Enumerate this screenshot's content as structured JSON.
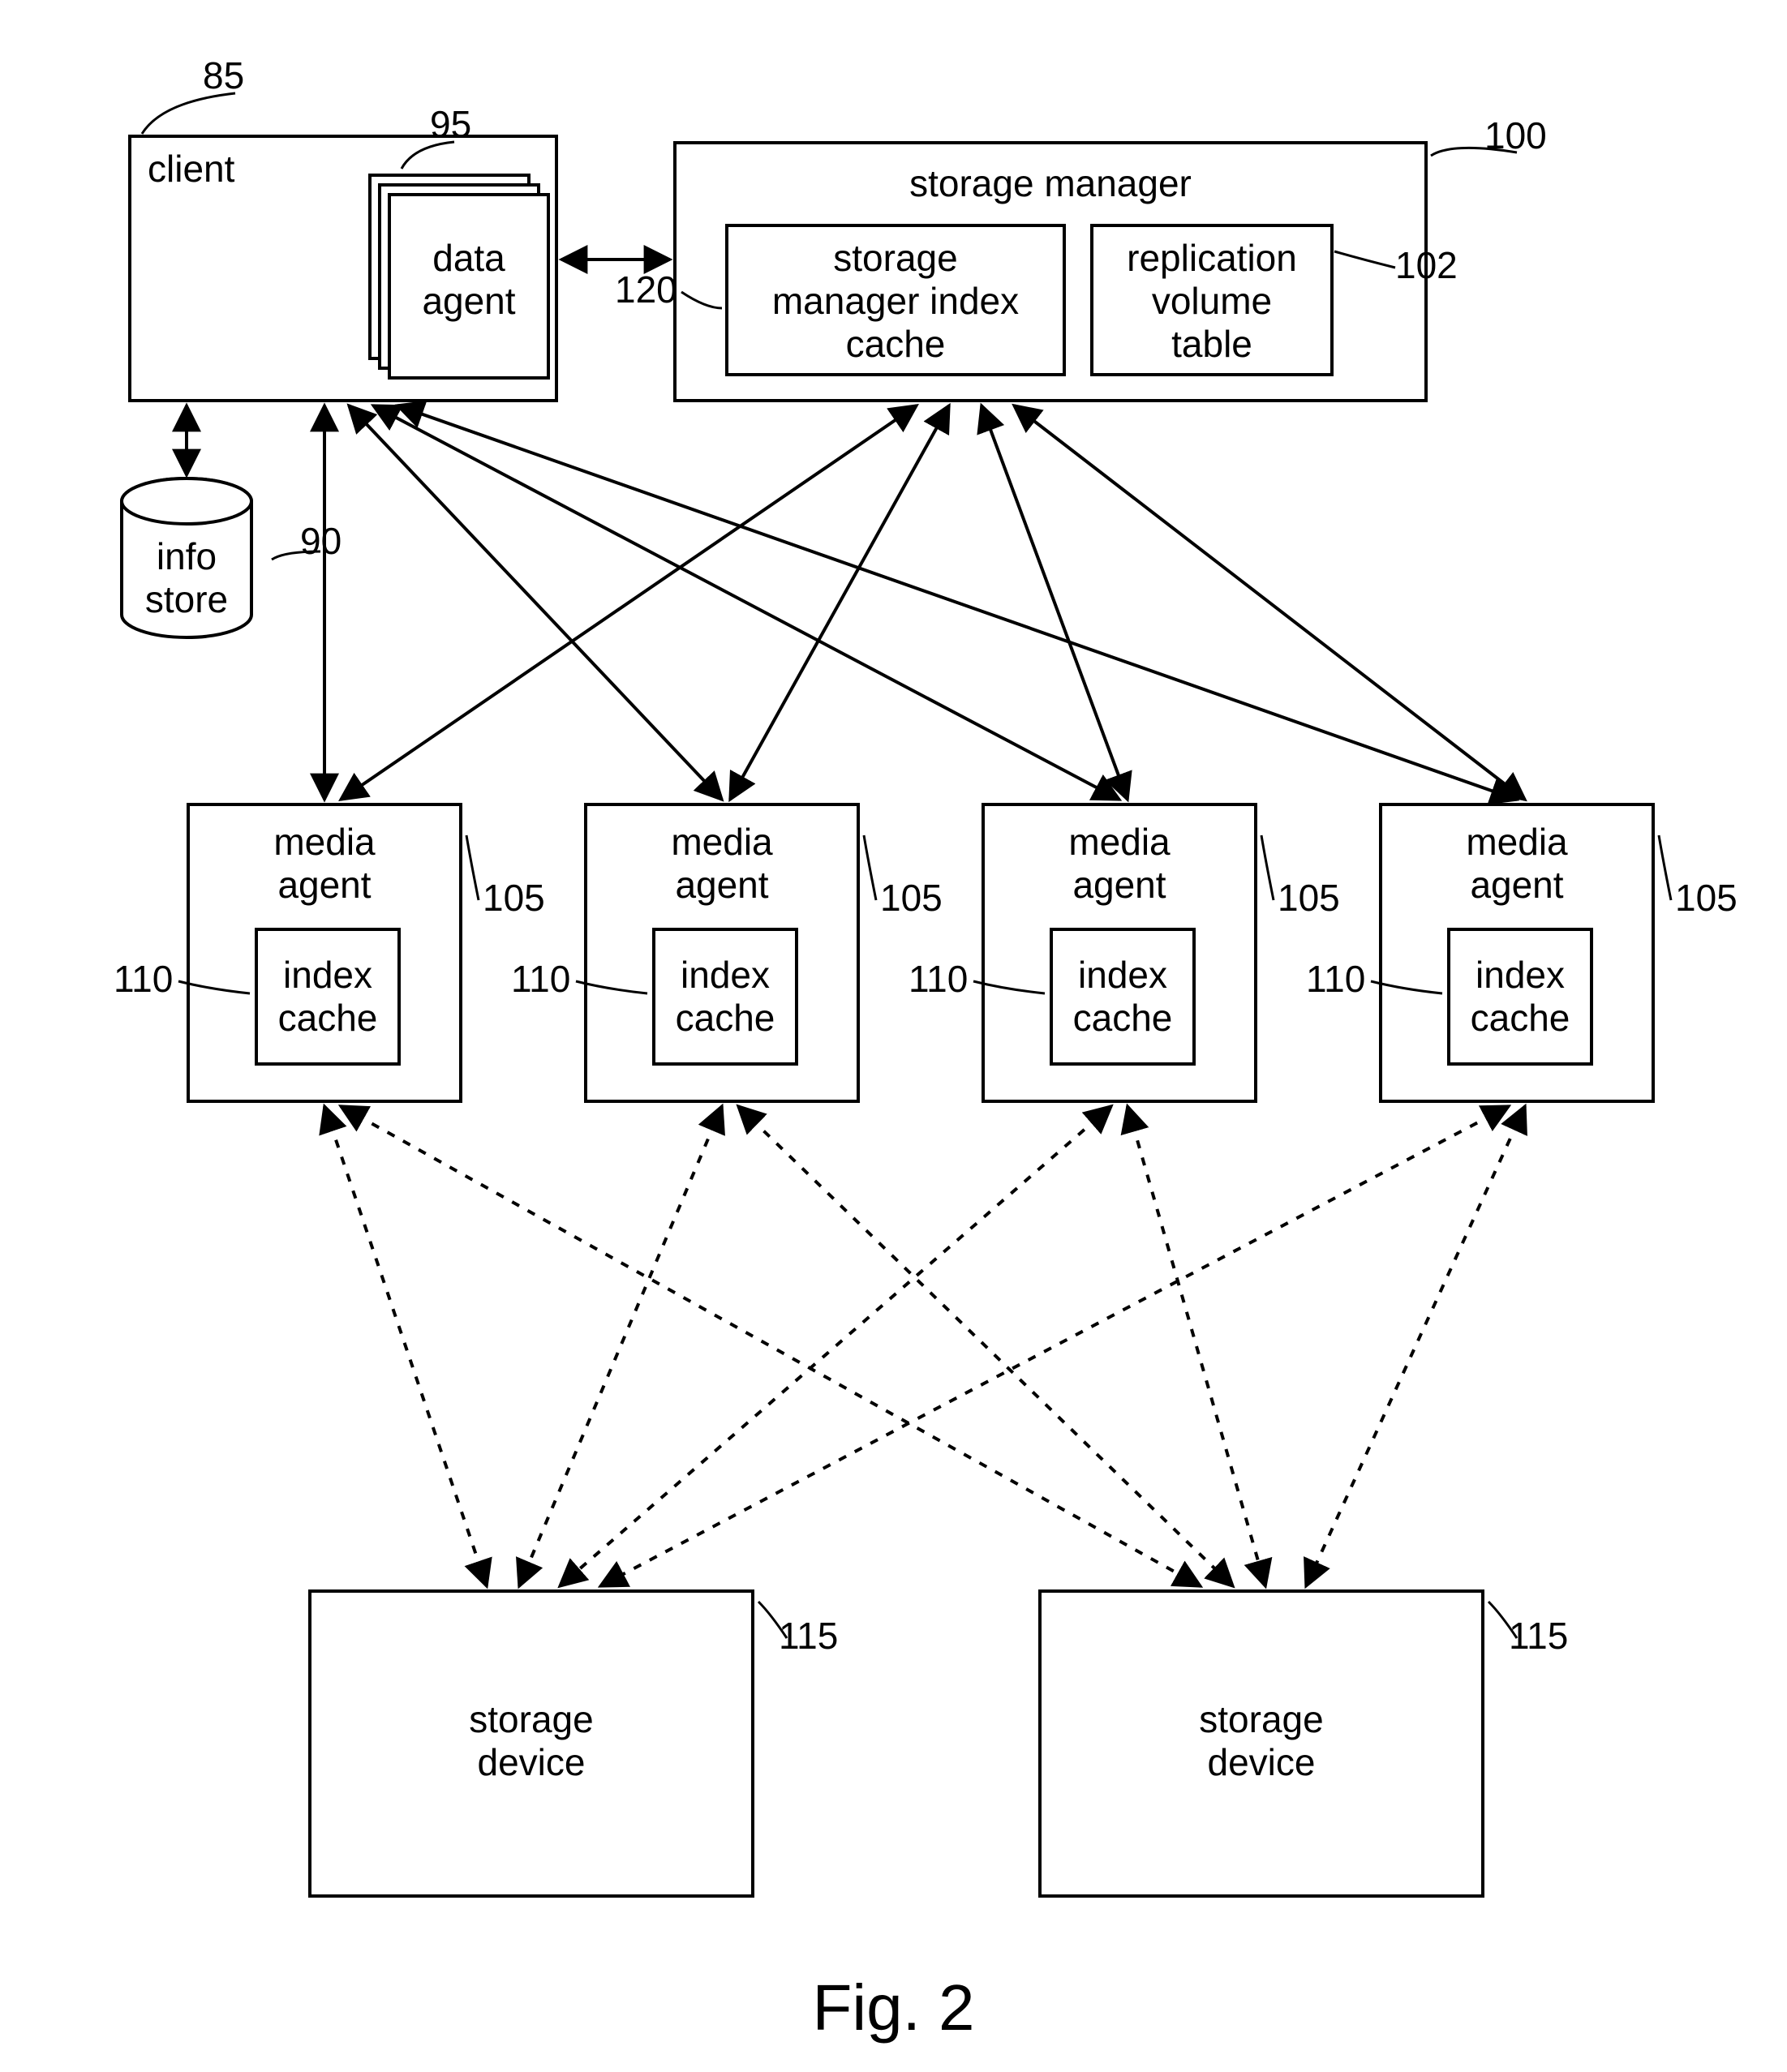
{
  "figure_caption": "Fig. 2",
  "client": {
    "label": "client",
    "ref": "85"
  },
  "data_agent": {
    "label": "data\nagent",
    "ref": "95"
  },
  "info_store": {
    "label": "info\nstore",
    "ref": "90"
  },
  "storage_manager": {
    "label": "storage manager",
    "ref": "100"
  },
  "sm_index_cache": {
    "label": "storage\nmanager index\ncache",
    "ref": "120"
  },
  "rep_vol_table": {
    "label": "replication\nvolume\ntable",
    "ref": "102"
  },
  "media_agents": [
    {
      "label": "media\nagent",
      "inner": "index\ncache",
      "ref_outer": "105",
      "ref_inner": "110"
    },
    {
      "label": "media\nagent",
      "inner": "index\ncache",
      "ref_outer": "105",
      "ref_inner": "110"
    },
    {
      "label": "media\nagent",
      "inner": "index\ncache",
      "ref_outer": "105",
      "ref_inner": "110"
    },
    {
      "label": "media\nagent",
      "inner": "index\ncache",
      "ref_outer": "105",
      "ref_inner": "110"
    }
  ],
  "storage_devices": [
    {
      "label": "storage\ndevice",
      "ref": "115"
    },
    {
      "label": "storage\ndevice",
      "ref": "115"
    }
  ]
}
